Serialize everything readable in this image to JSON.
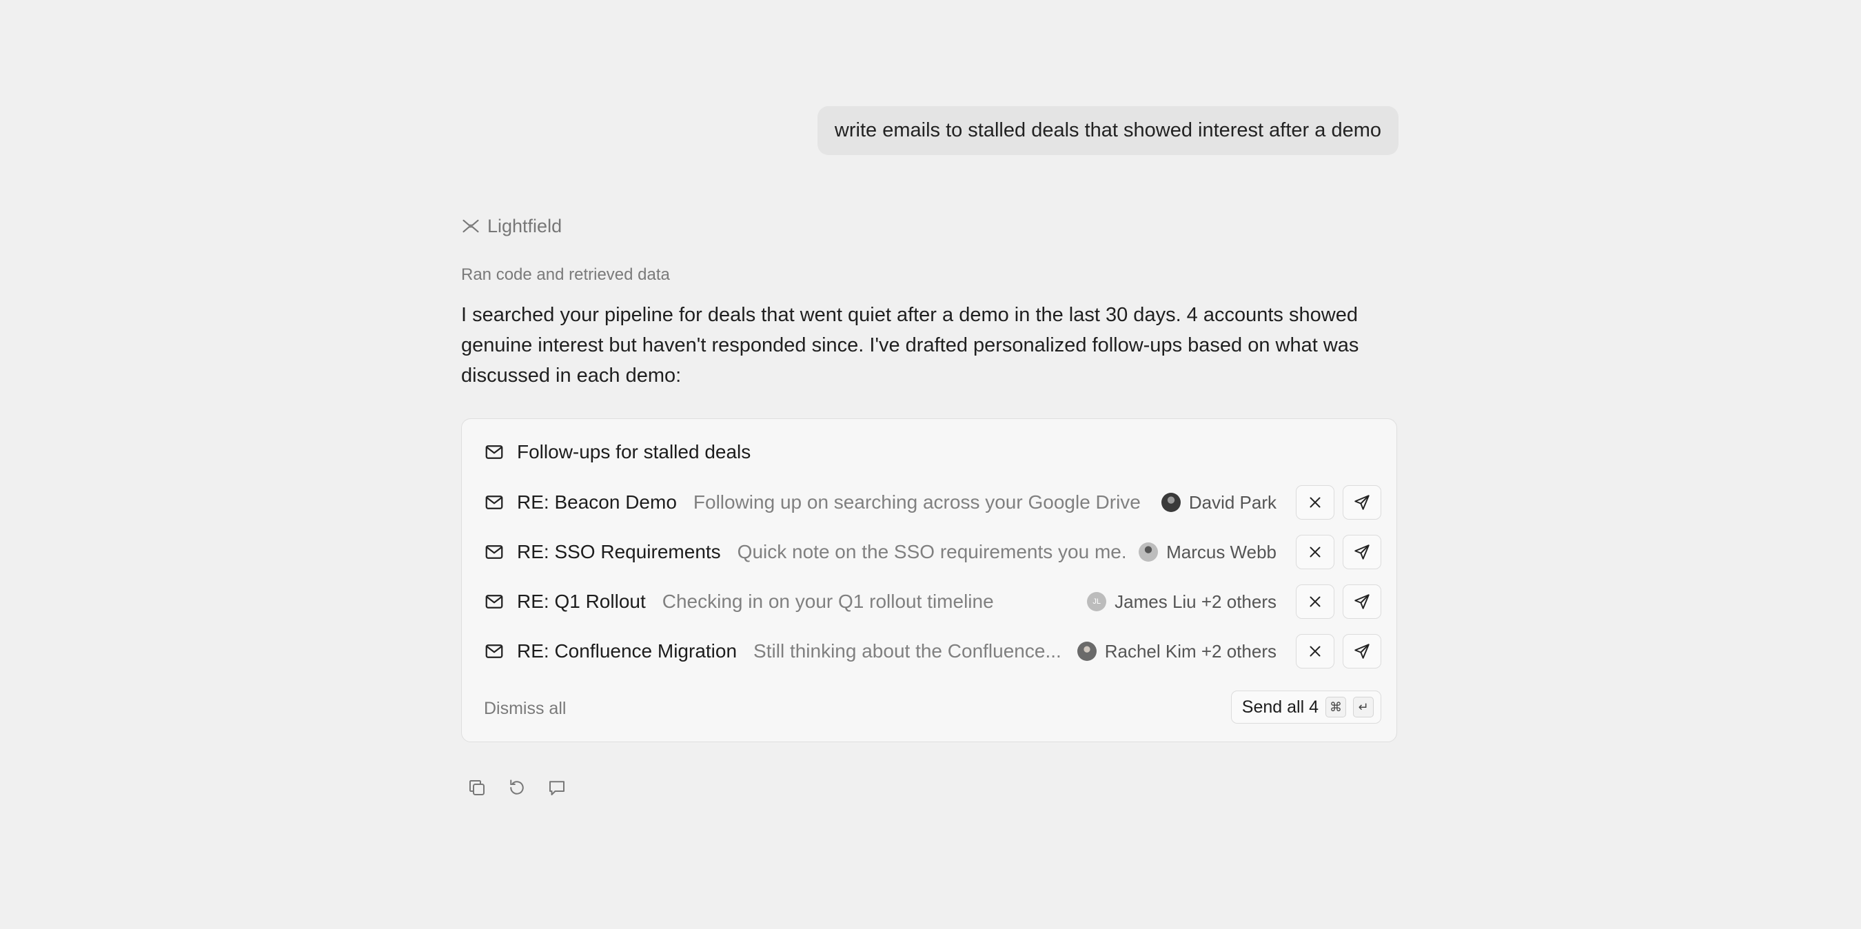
{
  "user_message": "write emails to stalled deals that showed interest after a demo",
  "assistant": {
    "brand": "Lightfield",
    "tool_note": "Ran code and retrieved data",
    "answer": "I searched your pipeline for deals that went quiet after a demo in the last 30 days. 4 accounts showed genuine interest but haven't responded since. I've drafted personalized follow-ups based on what was discussed in each demo:"
  },
  "card": {
    "title": "Follow-ups for stalled deals",
    "emails": [
      {
        "subject": "RE: Beacon Demo",
        "preview": "Following up on searching across your Google Drive",
        "recipient": "David Park",
        "avatar": ""
      },
      {
        "subject": "RE: SSO Requirements",
        "preview": "Quick note on the SSO requirements you me...",
        "recipient": "Marcus Webb",
        "avatar": ""
      },
      {
        "subject": "RE: Q1 Rollout",
        "preview": "Checking in on your Q1 rollout timeline",
        "recipient": "James Liu +2 others",
        "avatar": "JL"
      },
      {
        "subject": "RE: Confluence Migration",
        "preview": "Still thinking about the Confluence...",
        "recipient": "Rachel Kim +2 others",
        "avatar": ""
      }
    ],
    "dismiss_all": "Dismiss all",
    "send_all": "Send all 4",
    "shortcut_keys": [
      "⌘",
      "↵"
    ]
  },
  "icons": {
    "brand": "lightfield-logo-icon",
    "mail": "mail-icon",
    "dismiss": "close-icon",
    "send": "send-icon",
    "copy": "copy-icon",
    "retry": "retry-icon",
    "feedback": "comment-icon"
  }
}
